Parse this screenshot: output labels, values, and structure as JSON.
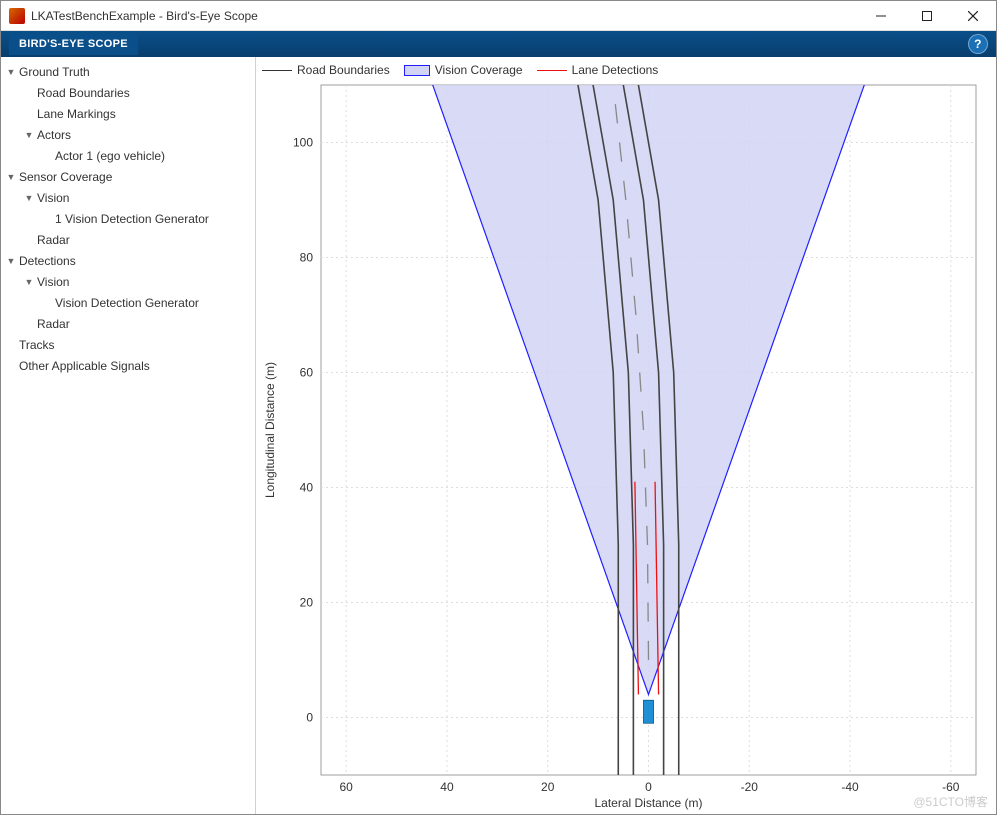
{
  "window": {
    "title": "LKATestBenchExample - Bird's-Eye Scope",
    "tab": "BIRD'S-EYE SCOPE",
    "help_tooltip": "?"
  },
  "tree": [
    {
      "label": "Ground Truth",
      "depth": 1,
      "exp": true,
      "children": [
        {
          "label": "Road Boundaries",
          "depth": 2
        },
        {
          "label": "Lane Markings",
          "depth": 2
        },
        {
          "label": "Actors",
          "depth": 2,
          "exp": true,
          "children": [
            {
              "label": "Actor 1 (ego vehicle)",
              "depth": 3
            }
          ]
        }
      ]
    },
    {
      "label": "Sensor Coverage",
      "depth": 1,
      "exp": true,
      "children": [
        {
          "label": "Vision",
          "depth": 2,
          "exp": true,
          "children": [
            {
              "label": "1 Vision Detection Generator",
              "depth": 3
            }
          ]
        },
        {
          "label": "Radar",
          "depth": 2
        }
      ]
    },
    {
      "label": "Detections",
      "depth": 1,
      "exp": true,
      "children": [
        {
          "label": "Vision",
          "depth": 2,
          "exp": true,
          "children": [
            {
              "label": "Vision Detection Generator",
              "depth": 3
            }
          ]
        },
        {
          "label": "Radar",
          "depth": 2
        }
      ]
    },
    {
      "label": "Tracks",
      "depth": 1
    },
    {
      "label": "Other Applicable Signals",
      "depth": 1
    }
  ],
  "legend": {
    "road": "Road Boundaries",
    "vision": "Vision Coverage",
    "lane": "Lane Detections"
  },
  "chart_data": {
    "type": "birdseye",
    "xlabel": "Lateral Distance (m)",
    "ylabel": "Longitudinal Distance (m)",
    "xlim": [
      65,
      -65
    ],
    "ylim": [
      -10,
      110
    ],
    "xticks": [
      60,
      40,
      20,
      0,
      -20,
      -40,
      -60
    ],
    "yticks": [
      0,
      20,
      40,
      60,
      80,
      100
    ],
    "ego": {
      "x": 0,
      "y": 0,
      "width": 2,
      "length": 4,
      "color": "#1f8fd6"
    },
    "vision_cone": {
      "apex": [
        0,
        4
      ],
      "half_angle_deg": 22,
      "range": 150,
      "color_fill": "#d1d4f5",
      "color_stroke": "#2020ff"
    },
    "road_boundaries": [
      [
        [
          6,
          -10
        ],
        [
          6,
          10
        ],
        [
          6,
          30
        ],
        [
          7,
          60
        ],
        [
          10,
          90
        ],
        [
          14,
          110
        ]
      ],
      [
        [
          -6,
          -10
        ],
        [
          -6,
          10
        ],
        [
          -6,
          30
        ],
        [
          -5,
          60
        ],
        [
          -2,
          90
        ],
        [
          2,
          110
        ]
      ]
    ],
    "lane_marking_center": {
      "dash": 4,
      "gap": 6,
      "points": [
        [
          0,
          10
        ],
        [
          0.2,
          30
        ],
        [
          1,
          50
        ],
        [
          2.5,
          70
        ],
        [
          4.5,
          90
        ],
        [
          7,
          110
        ]
      ]
    },
    "lane_edges": [
      [
        [
          3,
          -10
        ],
        [
          3,
          30
        ],
        [
          4,
          60
        ],
        [
          7,
          90
        ],
        [
          11,
          110
        ]
      ],
      [
        [
          -3,
          -10
        ],
        [
          -3,
          30
        ],
        [
          -2,
          60
        ],
        [
          1,
          90
        ],
        [
          5,
          110
        ]
      ]
    ],
    "lane_detections": [
      [
        [
          2,
          4
        ],
        [
          2.7,
          41
        ]
      ],
      [
        [
          -2,
          4
        ],
        [
          -1.3,
          41
        ]
      ]
    ],
    "colors": {
      "road": "#444",
      "lane_detect": "#e11",
      "center": "#888"
    }
  },
  "watermark": "@51CTO博客"
}
